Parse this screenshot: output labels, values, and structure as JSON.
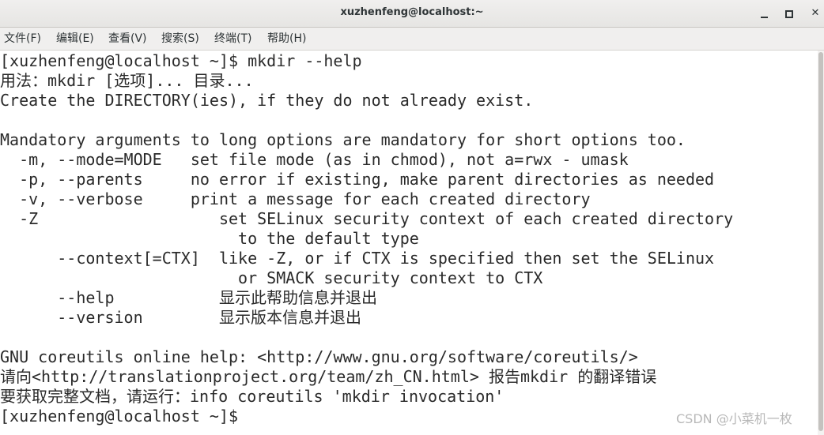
{
  "window": {
    "title": "xuzhenfeng@localhost:~",
    "controls": {
      "minimize_icon": "minimize-icon",
      "maximize_icon": "maximize-icon",
      "close_glyph": "✕"
    }
  },
  "menu": {
    "items": [
      "文件(F)",
      "编辑(E)",
      "查看(V)",
      "搜索(S)",
      "终端(T)",
      "帮助(H)"
    ]
  },
  "terminal": {
    "lines": [
      "[xuzhenfeng@localhost ~]$ mkdir --help",
      "用法：mkdir [选项]... 目录...",
      "Create the DIRECTORY(ies), if they do not already exist.",
      "",
      "Mandatory arguments to long options are mandatory for short options too.",
      "  -m, --mode=MODE   set file mode (as in chmod), not a=rwx - umask",
      "  -p, --parents     no error if existing, make parent directories as needed",
      "  -v, --verbose     print a message for each created directory",
      "  -Z                   set SELinux security context of each created directory",
      "                         to the default type",
      "      --context[=CTX]  like -Z, or if CTX is specified then set the SELinux",
      "                         or SMACK security context to CTX",
      "      --help           显示此帮助信息并退出",
      "      --version        显示版本信息并退出",
      "",
      "GNU coreutils online help: <http://www.gnu.org/software/coreutils/>",
      "请向<http://translationproject.org/team/zh_CN.html> 报告mkdir 的翻译错误",
      "要获取完整文档，请运行：info coreutils 'mkdir invocation'",
      "[xuzhenfeng@localhost ~]$"
    ]
  },
  "watermark": "CSDN @小菜机一枚",
  "colors": {
    "titlebar": "#e9e8e6",
    "terminal_bg": "#ffffff",
    "terminal_fg": "#2a2a2a"
  }
}
